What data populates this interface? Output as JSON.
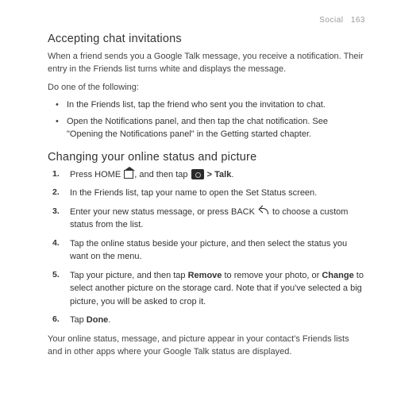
{
  "header": {
    "section": "Social",
    "page": "163"
  },
  "s1": {
    "title": "Accepting chat invitations",
    "intro": "When a friend sends you a Google Talk message, you receive a notification. Their entry in the Friends list turns white and displays the message.",
    "do_one": "Do one of the following:",
    "b1": "In the Friends list, tap the friend who sent you the invitation to chat.",
    "b2": "Open the Notifications panel, and then tap the chat notification. See \"Opening the Notifications panel\" in the Getting started chapter."
  },
  "s2": {
    "title": "Changing your online status and picture",
    "st1a": "Press HOME ",
    "st1b": ", and then tap ",
    "st1c": " > ",
    "st1d": "Talk",
    "st1e": ".",
    "st2": "In the Friends list, tap your name to open the Set Status screen.",
    "st3a": "Enter your new status message, or press BACK ",
    "st3b": " to choose a custom status from the list.",
    "st4": "Tap the online status beside your picture, and then select the status you want on the menu.",
    "st5a": "Tap your picture, and then tap ",
    "st5b": "Remove",
    "st5c": " to remove your photo, or ",
    "st5d": "Change",
    "st5e": " to select another picture on the storage card. Note that if you've selected a big picture, you will be asked to crop it.",
    "st6a": "Tap ",
    "st6b": "Done",
    "st6c": ".",
    "outro": "Your online status, message, and picture appear in your contact's Friends lists and in other apps where your Google Talk status are displayed."
  }
}
